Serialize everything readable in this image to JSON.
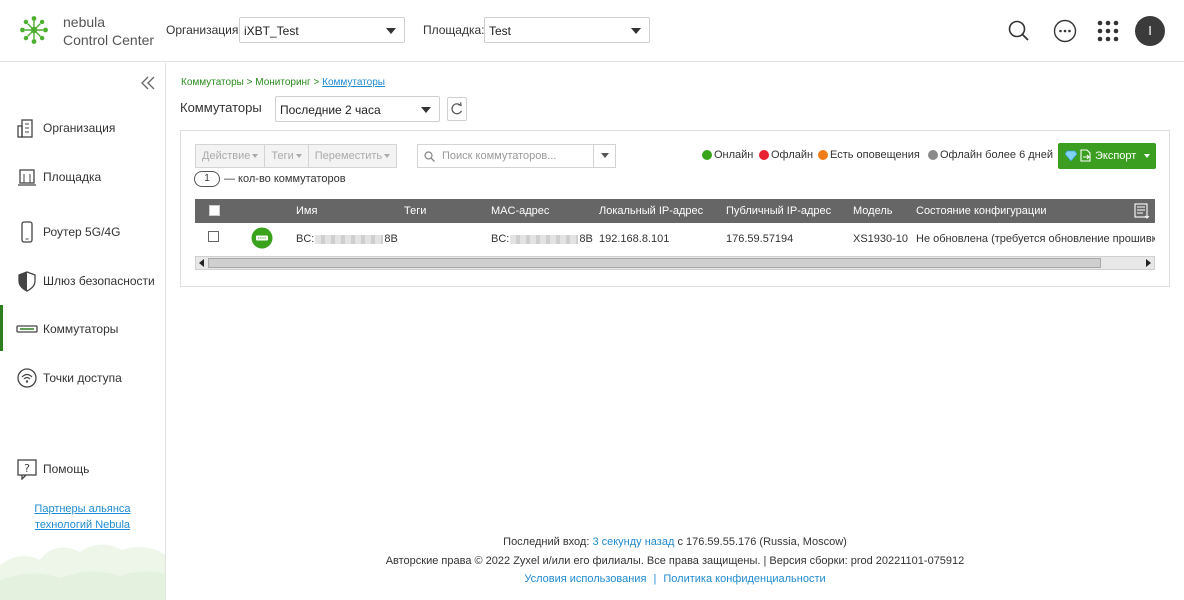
{
  "header": {
    "brand_line1": "nebula",
    "brand_line2": "Control Center",
    "org_label": "Организация:",
    "org_value": "iXBT_Test",
    "site_label": "Площадка:",
    "site_value": "Test",
    "avatar_letter": "I"
  },
  "sidebar": {
    "items": [
      {
        "label": "Организация",
        "icon": "building-icon"
      },
      {
        "label": "Площадка",
        "icon": "site-icon"
      },
      {
        "label": "Роутер 5G/4G",
        "icon": "phone-router-icon"
      },
      {
        "label": "Шлюз безопасности",
        "icon": "shield-icon"
      },
      {
        "label": "Коммутаторы",
        "icon": "switch-icon",
        "active": true
      },
      {
        "label": "Точки доступа",
        "icon": "wifi-ap-icon"
      },
      {
        "label": "Помощь",
        "icon": "help-icon"
      }
    ],
    "partner_line1": "Партнеры альянса",
    "partner_line2": "технологий Nebula"
  },
  "breadcrumb": {
    "part1": "Коммутаторы",
    "sep": " > ",
    "part2": "Мониторинг",
    "current": "Коммутаторы"
  },
  "page": {
    "title": "Коммутаторы",
    "time_range": "Последние 2 часа"
  },
  "toolbar": {
    "action": "Действие",
    "tags": "Теги",
    "move": "Переместить",
    "search_placeholder": "Поиск коммутаторов...",
    "export": "Экспорт"
  },
  "legend": {
    "online": "Онлайн",
    "offline": "Офлайн",
    "alerts": "Есть оповещения",
    "offline_6d": "Офлайн более 6 дней",
    "colors": {
      "online": "#3aa31c",
      "offline": "#e8232f",
      "alerts": "#f07d1a",
      "offline_6d": "#8a8a8a"
    }
  },
  "count": {
    "value": "1",
    "label": "— кол-во коммутаторов"
  },
  "table": {
    "columns": [
      "Имя",
      "Теги",
      "MAC-адрес",
      "Локальный IP-адрес",
      "Публичный IP-адрес",
      "Модель",
      "Состояние конфигурации"
    ],
    "rows": [
      {
        "name_start": "BC:",
        "name_end": "8B",
        "tags": "",
        "mac_start": "BC:",
        "mac_end": "8B",
        "local_ip": "192.168.8.101",
        "public_ip": "176.59.57194",
        "model": "XS1930-10",
        "config": "Не обновлена (требуется обновление прошивки)"
      }
    ]
  },
  "footer": {
    "last_login_label": "Последний вход:",
    "last_login_ago": "3 секунду назад",
    "last_login_from": "с 176.59.55.176 (Russia, Moscow)",
    "copyright": "Авторские права © 2022 Zyxel и/или его филиалы. Все права защищены. | Версия сборки: prod 20221101-075912",
    "terms": "Условия использования",
    "divider": "|",
    "privacy": "Политика конфиденциальности"
  }
}
